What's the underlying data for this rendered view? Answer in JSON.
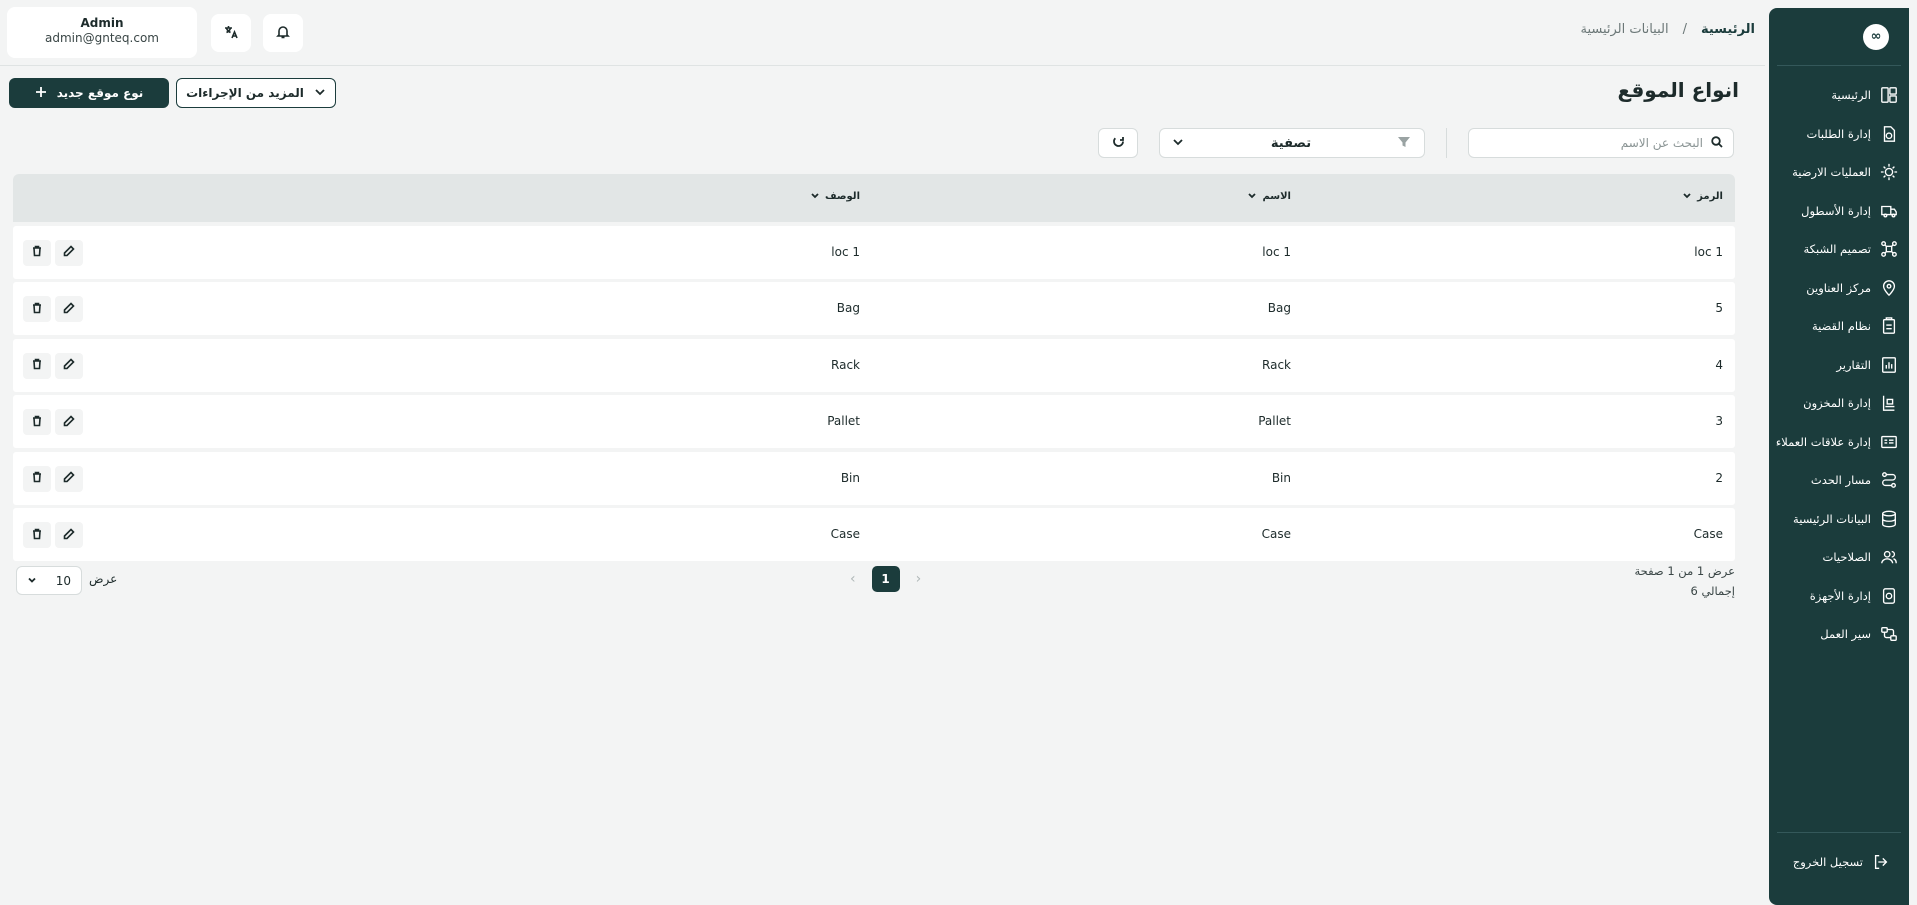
{
  "app": {
    "logo_text": "∞"
  },
  "breadcrumb": {
    "home": "الرئيسية",
    "separator": "/",
    "current": "البيانات الرئيسية"
  },
  "user": {
    "name": "Admin",
    "email": "admin@gnteq.com"
  },
  "header_icons": {
    "language": "translate-icon",
    "notifications": "bell-icon"
  },
  "sidebar": {
    "items": [
      {
        "label": "الرئيسية",
        "icon": "dashboard-icon"
      },
      {
        "label": "إدارة الطلبات",
        "icon": "orders-icon"
      },
      {
        "label": "العمليات الارضية",
        "icon": "ground-ops-icon"
      },
      {
        "label": "إدارة الأسطول",
        "icon": "truck-icon"
      },
      {
        "label": "تصميم الشبكة",
        "icon": "network-icon"
      },
      {
        "label": "مركز العناوين",
        "icon": "location-icon"
      },
      {
        "label": "نظام القضية",
        "icon": "case-icon"
      },
      {
        "label": "التقارير",
        "icon": "reports-icon"
      },
      {
        "label": "إدارة المخزون",
        "icon": "inventory-icon"
      },
      {
        "label": "إدارة علاقات العملاء",
        "icon": "crm-icon"
      },
      {
        "label": "مسار الحدث",
        "icon": "route-icon"
      },
      {
        "label": "البيانات الرئيسية",
        "icon": "database-icon"
      },
      {
        "label": "الصلاحيات",
        "icon": "users-icon"
      },
      {
        "label": "إدارة الأجهزة",
        "icon": "devices-icon"
      },
      {
        "label": "سير العمل",
        "icon": "workflow-icon"
      }
    ],
    "logout": "تسجيل الخروج"
  },
  "page": {
    "title": "انواع الموقع",
    "new_button": "نوع موقع جديد",
    "more_actions": "المزيد من الإجراءات",
    "search_placeholder": "البحث عن الاسم",
    "filter_label": "تصفية"
  },
  "table": {
    "columns": {
      "code": "الرمز",
      "name": "الاسم",
      "description": "الوصف"
    },
    "rows": [
      {
        "code": "loc 1",
        "name": "loc 1",
        "description": "loc 1"
      },
      {
        "code": "5",
        "name": "Bag",
        "description": "Bag"
      },
      {
        "code": "4",
        "name": "Rack",
        "description": "Rack"
      },
      {
        "code": "3",
        "name": "Pallet",
        "description": "Pallet"
      },
      {
        "code": "2",
        "name": "Bin",
        "description": "Bin"
      },
      {
        "code": "Case",
        "name": "Case",
        "description": "Case"
      }
    ]
  },
  "pagination": {
    "page_info": "عرض 1 من 1 صفحة",
    "total": "إجمالي 6",
    "current_page": "1",
    "per_page": "10",
    "per_page_label": "عرض"
  },
  "colors": {
    "primary": "#1b3c3c",
    "background": "#f3f4f4",
    "header_row": "#e2e6e6"
  }
}
